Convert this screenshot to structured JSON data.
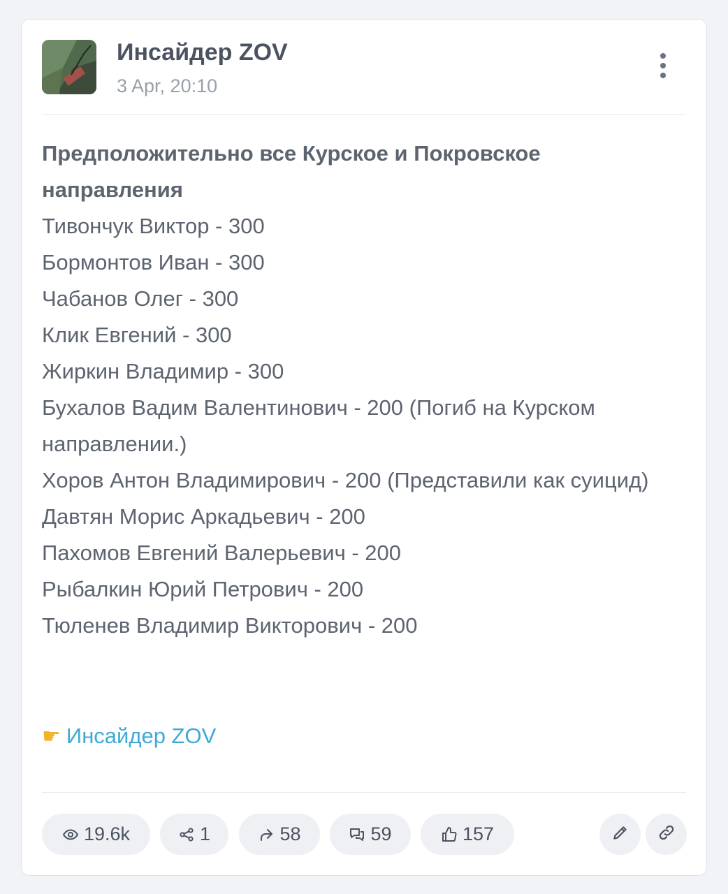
{
  "post": {
    "channel_name": "Инсайдер ZOV",
    "date": "3 Apr, 20:10",
    "lead": "Предположительно все Курское и Покровское направления",
    "lines": [
      "Тивончук Виктор - 300",
      "Бормонтов Иван - 300",
      "Чабанов Олег - 300",
      "Клик Евгений - 300",
      "Жиркин Владимир - 300",
      "Бухалов Вадим Валентинович - 200 (Погиб на Курском направлении.)",
      "Хоров Антон Владимирович - 200 (Представили как суицид)",
      "Давтян Морис Аркадьевич - 200",
      "Пахомов Евгений Валерьевич - 200",
      "Рыбалкин Юрий Петрович - 200",
      "Тюленев Владимир Викторович - 200"
    ],
    "signature_link": "Инсайдер ZOV"
  },
  "stats": {
    "views": "19.6k",
    "shares": "1",
    "forwards": "58",
    "comments": "59",
    "reactions": "157"
  },
  "icons": {
    "header": [
      "channel-avatar",
      "more-vertical-icon"
    ],
    "signature": "pointing-hand-icon",
    "stats": [
      "eye-icon",
      "share-icon",
      "forward-icon",
      "comments-icon",
      "thumbs-up-icon"
    ],
    "actions": [
      "pencil-icon",
      "link-icon"
    ]
  },
  "colors": {
    "link": "#3fa9d6",
    "text": "#5d6470",
    "muted": "#9aa0a9",
    "pill_bg": "#eef0f4"
  }
}
